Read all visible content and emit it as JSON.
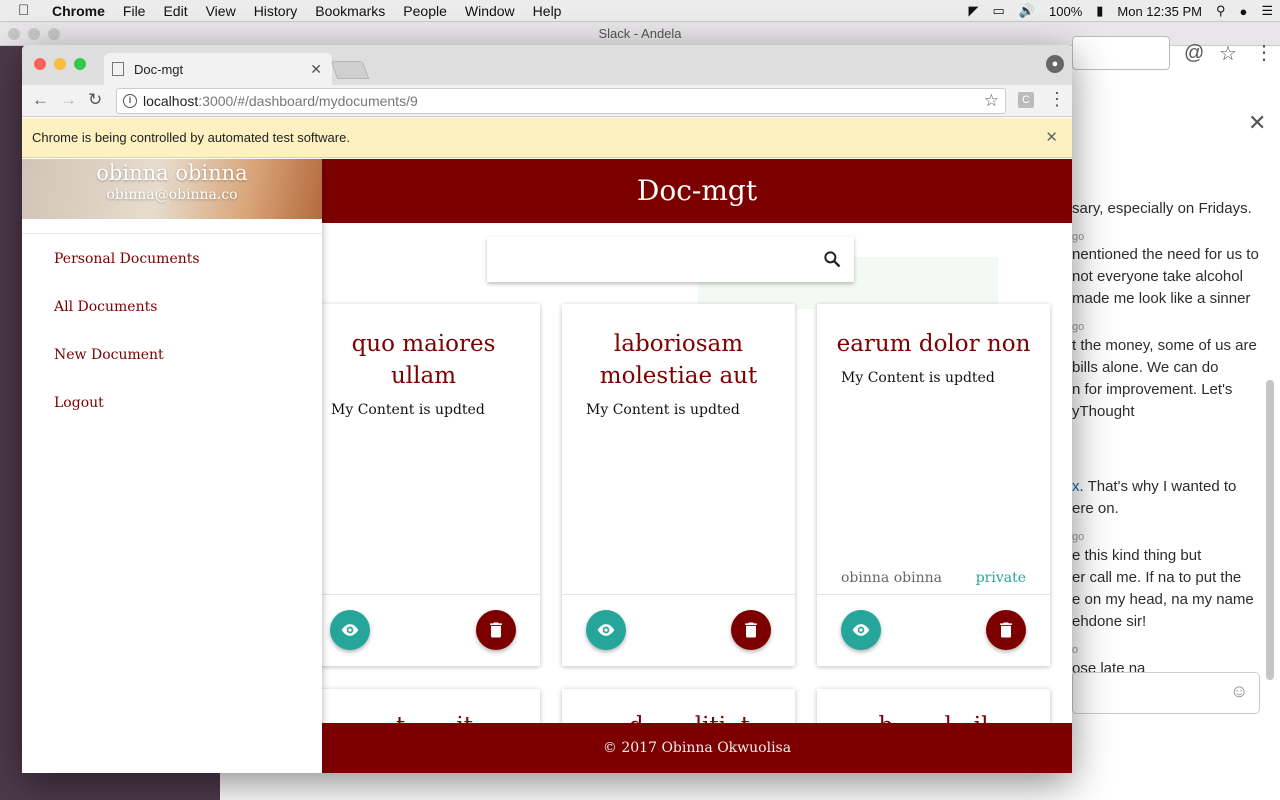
{
  "menubar": {
    "app": "Chrome",
    "items": [
      "File",
      "Edit",
      "View",
      "History",
      "Bookmarks",
      "People",
      "Window",
      "Help"
    ],
    "battery": "100%",
    "clock": "Mon 12:35 PM"
  },
  "slack": {
    "window_title": "Slack - Andela",
    "messages": [
      "sary, especially on Fridays.",
      "go",
      "nentioned the need for us to",
      "not everyone take alcohol",
      "made me look like a sinner",
      "go",
      "t the money, some of us are",
      "bills alone. We can do",
      "n for improvement. Let's",
      "yThought",
      "x",
      ". That's why I wanted to",
      "ere on.",
      "go",
      "e this kind thing but",
      "er call me. If na to put the",
      "e on my head, na my name",
      "ehdone sir!",
      "o",
      "ose late na"
    ]
  },
  "browser": {
    "tab_title": "Doc-mgt",
    "url_host": "localhost",
    "url_path": ":3000/#/dashboard/mydocuments/9",
    "extension_label": "C",
    "infobar_text": "Chrome is being controlled by automated test software."
  },
  "app": {
    "header_title": "Doc-mgt",
    "footer_text": "© 2017 Obinna Okwuolisa",
    "user": {
      "name": "obinna obinna",
      "email": "obinna@obinna.co"
    },
    "nav": [
      "Personal Documents",
      "All Documents",
      "New Document",
      "Logout"
    ],
    "cards": [
      {
        "title": "quo maiores ullam",
        "content": "My Content is updted",
        "owner": "",
        "access": ""
      },
      {
        "title": "laboriosam molestiae aut",
        "content": "My Content is updted",
        "owner": "",
        "access": ""
      },
      {
        "title": "earum dolor non",
        "content": "My Content is updted",
        "owner": "obinna obinna",
        "access": "private"
      }
    ],
    "next_row_titles": [
      "...t... ...it",
      "...d... ...liti..t",
      "...b... ...l...il..."
    ]
  },
  "colors": {
    "brand": "#7d0000",
    "accent": "#26a69a",
    "warning_bar": "#fdf0c1"
  }
}
